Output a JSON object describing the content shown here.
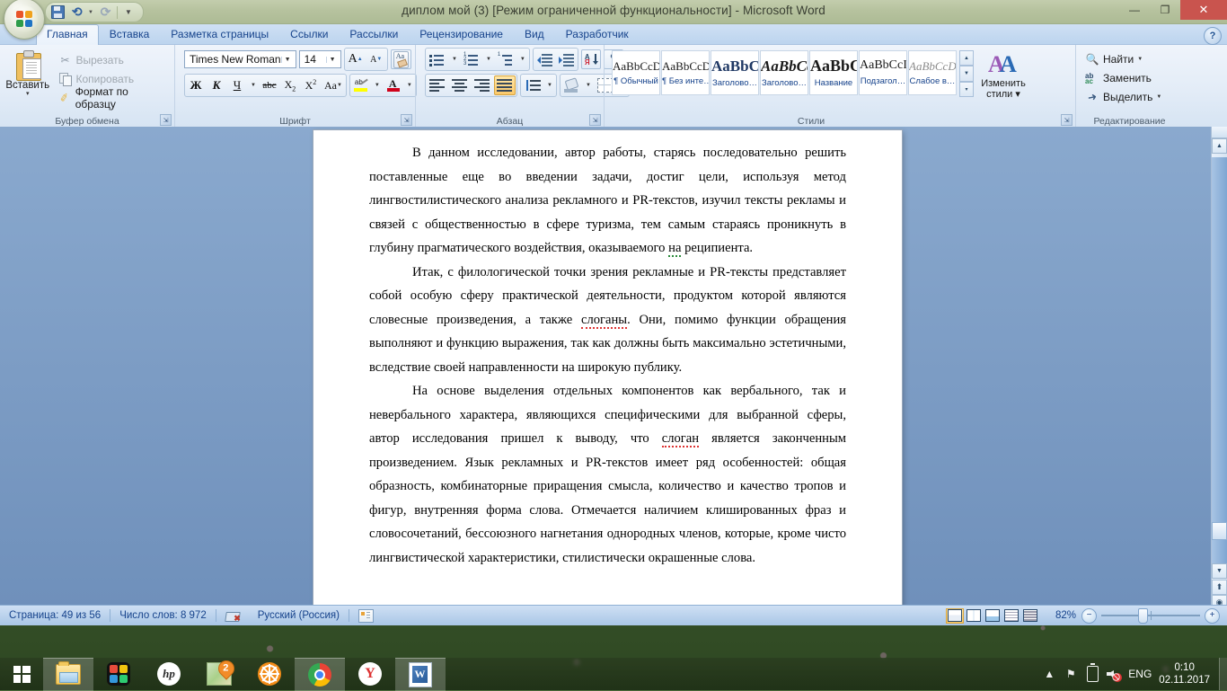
{
  "window": {
    "title": "диплом мой (3) [Режим ограниченной функциональности] - Microsoft Word",
    "minimize_label": "—",
    "restore_label": "❐",
    "close_label": "✕",
    "help_label": "?"
  },
  "quick_access": {
    "office_button": "office-orb",
    "save_label": "Сохранить",
    "undo_label": "Отменить",
    "redo_label": "Вернуть",
    "customize_label": "▾"
  },
  "tabs": [
    {
      "label": "Главная",
      "active": true
    },
    {
      "label": "Вставка",
      "active": false
    },
    {
      "label": "Разметка страницы",
      "active": false
    },
    {
      "label": "Ссылки",
      "active": false
    },
    {
      "label": "Рассылки",
      "active": false
    },
    {
      "label": "Рецензирование",
      "active": false
    },
    {
      "label": "Вид",
      "active": false
    },
    {
      "label": "Разработчик",
      "active": false
    }
  ],
  "ribbon": {
    "clipboard": {
      "group_label": "Буфер обмена",
      "paste_label": "Вставить",
      "paste_caret": "▾",
      "cut_label": "Вырезать",
      "copy_label": "Копировать",
      "format_painter_label": "Формат по образцу",
      "dialog_launcher": "⇲"
    },
    "font": {
      "group_label": "Шрифт",
      "font_name": "Times New Roman",
      "font_size": "14",
      "grow_label": "A",
      "shrink_label": "A",
      "clear_format_label": "Очистить формат",
      "bold_label": "Ж",
      "italic_label": "К",
      "underline_label": "Ч",
      "strike_label": "abc",
      "subscript_label": "X",
      "superscript_label": "X",
      "change_case_label": "Aa",
      "highlight_label": "ab",
      "font_color_label": "A",
      "caret": "▾",
      "dialog_launcher": "⇲"
    },
    "paragraph": {
      "group_label": "Абзац",
      "bullets_label": "Маркеры",
      "numbering_label": "Нумерация",
      "multilevel_label": "Многоуровневый список",
      "decrease_indent_label": "Уменьшить отступ",
      "increase_indent_label": "Увеличить отступ",
      "sort_label": "Сортировка",
      "marks_label": "¶",
      "align_left_label": "По левому краю",
      "align_center_label": "По центру",
      "align_right_label": "По правому краю",
      "justify_label": "По ширине",
      "line_spacing_label": "Междустрочный интервал",
      "shading_label": "Заливка",
      "borders_label": "Границы",
      "caret": "▾",
      "dialog_launcher": "⇲"
    },
    "styles": {
      "group_label": "Стили",
      "items": [
        {
          "sample": "AaBbCcDc",
          "name": "¶ Обычный",
          "style": "normal"
        },
        {
          "sample": "AaBbCcDc",
          "name": "¶ Без инте…",
          "style": "normal"
        },
        {
          "sample": "AaBbCс",
          "name": "Заголово…",
          "style": "heading1"
        },
        {
          "sample": "AaBbCс",
          "name": "Заголово…",
          "style": "heading2"
        },
        {
          "sample": "AaBbC",
          "name": "Название",
          "style": "title"
        },
        {
          "sample": "AaBbCcI",
          "name": "Подзагол…",
          "style": "subtitle"
        },
        {
          "sample": "AaBbCcDc",
          "name": "Слабое в…",
          "style": "subtle"
        }
      ],
      "scroll_up": "▲",
      "scroll_down": "▼",
      "more": "▾",
      "change_styles_label": "Изменить стили ▾",
      "dialog_launcher": "⇲"
    },
    "editing": {
      "group_label": "Редактирование",
      "find_label": "Найти",
      "replace_label": "Заменить",
      "select_label": "Выделить",
      "caret": "▾"
    }
  },
  "document": {
    "paragraphs": [
      [
        {
          "t": "В данном исследовании, автор работы, старясь последовательно решить поставленные еще во введении задачи, достиг цели, используя метод лингвостилистического анализа рекламного и PR-текстов, изучил тексты рекламы и связей  с общественностью в сфере туризма, тем самым стараясь проникнуть в глубину прагматического воздействия, оказываемого "
        },
        {
          "t": "на",
          "mark": "green"
        },
        {
          "t": " реципиента."
        }
      ],
      [
        {
          "t": "Итак, с филологической точки зрения рекламные и PR-тексты представляет собой особую сферу практической деятельности, продуктом которой являются словесные произведения, а также "
        },
        {
          "t": "слоганы",
          "mark": "red"
        },
        {
          "t": ". Они, помимо функции обращения выполняют и функцию выражения, так как должны быть максимально эстетичными, вследствие своей направленности на широкую публику."
        }
      ],
      [
        {
          "t": "На основе выделения отдельных компонентов как вербального, так и невербального характера, являющихся специфическими для выбранной сферы, автор исследования пришел к выводу, что "
        },
        {
          "t": "слоган",
          "mark": "red"
        },
        {
          "t": " является законченным произведением. Язык рекламных и PR-текстов имеет ряд особенностей: общая образность, комбинаторные приращения смысла, количество и качество тропов и фигур, внутренняя форма слова. Отмечается наличием клишированных фраз и словосочетаний, бессоюзного нагнетания однородных членов, которые, кроме чисто лингвистической характеристики, стилистически окрашенные слова."
        }
      ]
    ]
  },
  "scrollbar": {
    "up_label": "▲",
    "down_label": "▼",
    "prev_page_label": "⬆",
    "select_object_label": "◉",
    "next_page_label": "⬇"
  },
  "status_bar": {
    "page_label": "Страница: 49 из 56",
    "words_label": "Число слов: 8 972",
    "proofing_label": "proofing-errors-icon",
    "language_label": "Русский (Россия)",
    "macro_label": "macro-record-icon",
    "views": [
      {
        "name": "print-layout",
        "active": true
      },
      {
        "name": "full-screen-reading",
        "active": false
      },
      {
        "name": "web-layout",
        "active": false
      },
      {
        "name": "outline",
        "active": false
      },
      {
        "name": "draft",
        "active": false
      }
    ],
    "zoom_value": "82%",
    "zoom_out_label": "−",
    "zoom_in_label": "+"
  },
  "taskbar": {
    "start_label": "Пуск",
    "items": [
      {
        "name": "file-explorer",
        "active": true
      },
      {
        "name": "puzzle-app",
        "active": false
      },
      {
        "name": "hp-app",
        "active": false
      },
      {
        "name": "maps-app",
        "badge": "2",
        "active": false
      },
      {
        "name": "wheel-app",
        "active": false
      },
      {
        "name": "google-chrome",
        "active": true
      },
      {
        "name": "yandex-browser",
        "badge": "Y",
        "active": false
      },
      {
        "name": "microsoft-word",
        "active": true
      }
    ],
    "tray": {
      "show_hidden_label": "▲",
      "network_label": "network-icon",
      "battery_label": "battery-icon",
      "volume_label": "volume-muted-icon",
      "language_label": "ENG",
      "time": "0:10",
      "date": "02.11.2017"
    }
  }
}
